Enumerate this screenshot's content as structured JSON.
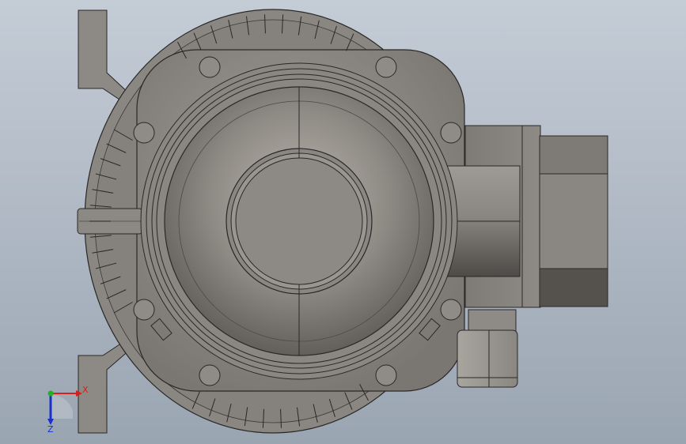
{
  "viewport": {
    "background_top": "#c4ccd6",
    "background_bottom": "#9aa5b2"
  },
  "model": {
    "body_color": "#8d8984",
    "edge_color": "#2a2826",
    "highlight_color": "#b5b0a9",
    "shadow_color": "#5d5a56"
  },
  "triad": {
    "x_label": "X",
    "z_label": "Z",
    "x_color": "#d81f1f",
    "y_color": "#1fb31f",
    "z_color": "#1a2fcc",
    "icon": "coordinate-triad-icon"
  }
}
